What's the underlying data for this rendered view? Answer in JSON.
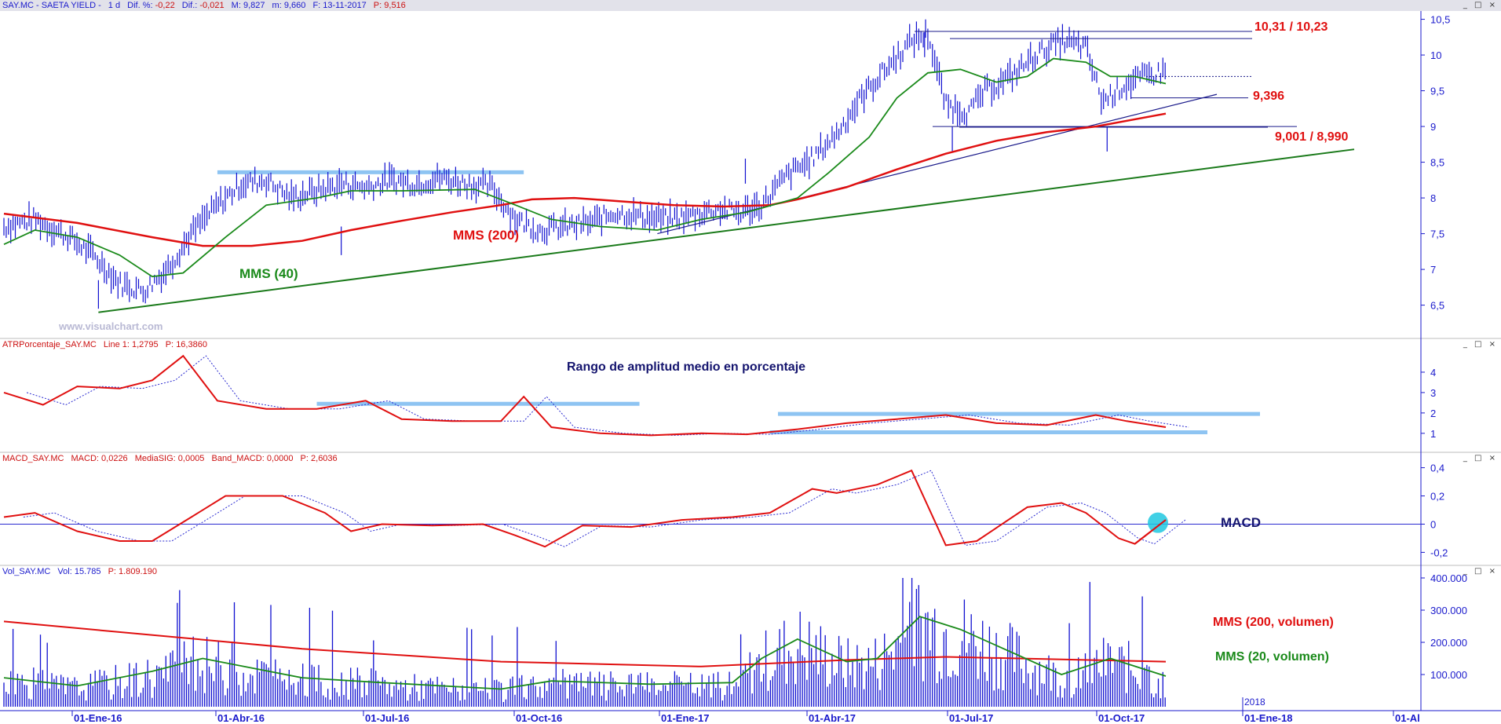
{
  "window_controls": "_ □ ×",
  "price_panel": {
    "symbol": "SAY.MC - SAETA YIELD -",
    "timeframe": "1 d",
    "dif_pct_label": "Dif. %:",
    "dif_pct_value": "-0,22",
    "dif_label": "Dif.:",
    "dif_value": "-0,021",
    "max_label": "M:",
    "max_value": "9,827",
    "min_label": "m:",
    "min_value": "9,660",
    "date_label": "F:",
    "date_value": "13-11-2017",
    "price_label": "P:",
    "price_value": "9,516",
    "watermark": "www.visualchart.com",
    "annotations": {
      "resistance": "10,31 / 10,23",
      "support1": "9,396",
      "support2": "9,001 / 8,990",
      "mms200": "MMS (200)",
      "mms40": "MMS (40)"
    }
  },
  "atr_panel": {
    "name": "ATRPorcentaje_SAY.MC",
    "line_label": "Line 1:",
    "line_value": "1,2795",
    "p_label": "P:",
    "p_value": "16,3860",
    "title": "Rango de amplitud medio en porcentaje"
  },
  "macd_panel": {
    "name": "MACD_SAY.MC",
    "macd_label": "MACD:",
    "macd_value": "0,0226",
    "sig_label": "MediaSIG:",
    "sig_value": "0,0005",
    "band_label": "Band_MACD:",
    "band_value": "0,0000",
    "p_label": "P:",
    "p_value": "2,6036",
    "title": "MACD"
  },
  "vol_panel": {
    "name": "Vol_SAY.MC",
    "vol_label": "Vol:",
    "vol_value": "15.785",
    "p_label": "P:",
    "p_value": "1.809.190",
    "annotations": {
      "mms200": "MMS (200, volumen)",
      "mms20": "MMS (20, volumen)"
    }
  },
  "colors": {
    "price_bars": "#1010d0",
    "mms200": "#e01010",
    "mms40": "#1a8a1a",
    "trendline_green": "#1a7a1a",
    "levels": "#1a1a8a",
    "bands": "#8ec4f2",
    "macd_highlight": "#20c8e0",
    "axis_text": "#1a1acc"
  },
  "chart_data": [
    {
      "type": "line",
      "panel": "price",
      "x_tick_labels": [
        "01-Ene-16",
        "01-Abr-16",
        "01-Jul-16",
        "01-Oct-16",
        "01-Ene-17",
        "01-Abr-17",
        "01-Jul-17",
        "01-Oct-17",
        "2018",
        "01-Ene-18",
        "01-Al"
      ],
      "y_tick_labels": [
        "6,5",
        "7",
        "7,5",
        "8",
        "8,5",
        "9",
        "9,5",
        "10",
        "10,5"
      ],
      "ylim": [
        6.1,
        10.55
      ],
      "series": [
        {
          "name": "MMS (200)",
          "x": [
            "2015-12-01",
            "2016-01-15",
            "2016-03-01",
            "2016-04-01",
            "2016-05-01",
            "2016-06-01",
            "2016-07-01",
            "2016-08-01",
            "2016-09-01",
            "2016-10-01",
            "2016-10-20",
            "2016-11-15",
            "2016-12-15",
            "2017-01-15",
            "2017-02-15",
            "2017-03-15",
            "2017-04-01",
            "2017-05-01",
            "2017-06-01",
            "2017-07-01",
            "2017-08-01",
            "2017-09-01",
            "2017-10-01",
            "2017-11-13"
          ],
          "values": [
            7.78,
            7.65,
            7.45,
            7.33,
            7.33,
            7.4,
            7.55,
            7.68,
            7.8,
            7.9,
            7.98,
            8.0,
            7.95,
            7.9,
            7.88,
            7.9,
            7.98,
            8.15,
            8.4,
            8.62,
            8.8,
            8.92,
            9.0,
            9.18
          ]
        },
        {
          "name": "MMS (40)",
          "x": [
            "2015-12-01",
            "2015-12-20",
            "2016-01-15",
            "2016-02-10",
            "2016-03-01",
            "2016-03-20",
            "2016-04-15",
            "2016-05-10",
            "2016-06-10",
            "2016-07-01",
            "2016-08-01",
            "2016-09-15",
            "2016-10-10",
            "2016-11-01",
            "2016-12-01",
            "2017-01-05",
            "2017-02-01",
            "2017-03-01",
            "2017-04-01",
            "2017-04-20",
            "2017-05-15",
            "2017-06-01",
            "2017-06-20",
            "2017-07-10",
            "2017-08-01",
            "2017-08-20",
            "2017-09-05",
            "2017-09-25",
            "2017-10-10",
            "2017-10-25",
            "2017-11-13"
          ],
          "values": [
            7.35,
            7.55,
            7.45,
            7.2,
            6.9,
            6.95,
            7.45,
            7.9,
            8.0,
            8.1,
            8.1,
            8.12,
            7.9,
            7.7,
            7.6,
            7.55,
            7.7,
            7.8,
            8.0,
            8.35,
            8.85,
            9.4,
            9.75,
            9.8,
            9.62,
            9.7,
            9.95,
            9.9,
            9.7,
            9.7,
            9.6
          ]
        },
        {
          "name": "price",
          "x": [
            "2015-12-01",
            "2015-12-20",
            "2016-01-10",
            "2016-01-25",
            "2016-02-10",
            "2016-02-25",
            "2016-03-10",
            "2016-03-25",
            "2016-04-10",
            "2016-04-25",
            "2016-05-10",
            "2016-05-25",
            "2016-06-10",
            "2016-06-25",
            "2016-07-10",
            "2016-07-25",
            "2016-08-10",
            "2016-08-25",
            "2016-09-10",
            "2016-09-25",
            "2016-10-10",
            "2016-10-25",
            "2016-11-10",
            "2016-11-25",
            "2016-12-10",
            "2016-12-25",
            "2017-01-10",
            "2017-01-25",
            "2017-02-10",
            "2017-02-25",
            "2017-03-10",
            "2017-03-25",
            "2017-04-10",
            "2017-04-25",
            "2017-05-10",
            "2017-05-25",
            "2017-06-10",
            "2017-06-20",
            "2017-07-01",
            "2017-07-15",
            "2017-07-25",
            "2017-08-10",
            "2017-08-25",
            "2017-09-10",
            "2017-09-25",
            "2017-10-05",
            "2017-10-20",
            "2017-11-01",
            "2017-11-13"
          ],
          "values": [
            7.6,
            7.7,
            7.45,
            7.2,
            6.8,
            6.7,
            7.0,
            7.5,
            7.9,
            8.2,
            8.25,
            8.0,
            8.1,
            8.2,
            8.15,
            8.25,
            8.2,
            8.28,
            8.2,
            8.15,
            7.7,
            7.55,
            7.6,
            7.65,
            7.8,
            7.75,
            7.7,
            7.75,
            7.85,
            7.8,
            7.9,
            8.3,
            8.55,
            8.9,
            9.4,
            9.8,
            10.2,
            10.3,
            9.3,
            9.2,
            9.5,
            9.7,
            10.0,
            10.2,
            10.1,
            9.35,
            9.6,
            9.7,
            9.78
          ]
        }
      ]
    },
    {
      "type": "line",
      "panel": "atr",
      "y_tick_labels": [
        "1",
        "2",
        "3",
        "4"
      ],
      "ylim": [
        0.3,
        5.0
      ],
      "series": [
        {
          "name": "atr",
          "x": [
            "2015-12-01",
            "2015-12-25",
            "2016-01-15",
            "2016-02-10",
            "2016-03-01",
            "2016-03-20",
            "2016-04-10",
            "2016-05-10",
            "2016-06-10",
            "2016-07-10",
            "2016-08-01",
            "2016-09-01",
            "2016-10-01",
            "2016-10-15",
            "2016-11-01",
            "2016-12-01",
            "2017-01-01",
            "2017-02-01",
            "2017-03-01",
            "2017-04-01",
            "2017-05-01",
            "2017-06-01",
            "2017-07-01",
            "2017-08-01",
            "2017-09-01",
            "2017-10-01",
            "2017-10-20",
            "2017-11-13"
          ],
          "values": [
            3.0,
            2.4,
            3.3,
            3.2,
            3.6,
            4.8,
            2.6,
            2.2,
            2.2,
            2.6,
            1.7,
            1.6,
            1.6,
            2.8,
            1.3,
            1.0,
            0.9,
            1.0,
            0.95,
            1.2,
            1.5,
            1.7,
            1.9,
            1.5,
            1.4,
            1.9,
            1.6,
            1.3
          ]
        }
      ]
    },
    {
      "type": "line",
      "panel": "macd",
      "y_tick_labels": [
        "-0,2",
        "0",
        "0,2",
        "0,4"
      ],
      "ylim": [
        -0.27,
        0.42
      ],
      "series": [
        {
          "name": "macd",
          "x": [
            "2015-12-01",
            "2015-12-20",
            "2016-01-15",
            "2016-02-10",
            "2016-03-01",
            "2016-03-25",
            "2016-04-15",
            "2016-05-20",
            "2016-06-15",
            "2016-07-01",
            "2016-07-20",
            "2016-08-20",
            "2016-09-20",
            "2016-10-10",
            "2016-10-28",
            "2016-11-20",
            "2016-12-20",
            "2017-01-20",
            "2017-02-20",
            "2017-03-15",
            "2017-04-10",
            "2017-04-25",
            "2017-05-20",
            "2017-06-10",
            "2017-07-01",
            "2017-07-20",
            "2017-08-20",
            "2017-09-10",
            "2017-09-25",
            "2017-10-15",
            "2017-10-25",
            "2017-11-13"
          ],
          "values": [
            0.05,
            0.08,
            -0.05,
            -0.12,
            -0.12,
            0.05,
            0.2,
            0.2,
            0.08,
            -0.05,
            0.0,
            -0.01,
            0.0,
            -0.08,
            -0.16,
            -0.01,
            -0.02,
            0.03,
            0.05,
            0.08,
            0.25,
            0.22,
            0.28,
            0.38,
            -0.15,
            -0.12,
            0.12,
            0.15,
            0.08,
            -0.1,
            -0.14,
            0.03
          ]
        }
      ]
    },
    {
      "type": "bar",
      "panel": "volume",
      "y_tick_labels": [
        "100.000",
        "200.000",
        "300.000",
        "400.000"
      ],
      "ylim": [
        0,
        400000
      ],
      "series": [
        {
          "name": "MMS (200, volumen)",
          "x": [
            "2015-12-01",
            "2016-06-01",
            "2016-10-01",
            "2017-02-01",
            "2017-05-01",
            "2017-07-01",
            "2017-11-13"
          ],
          "values": [
            265000,
            180000,
            140000,
            125000,
            145000,
            155000,
            140000
          ]
        },
        {
          "name": "MMS (20, volumen)",
          "x": [
            "2015-12-01",
            "2016-01-15",
            "2016-03-01",
            "2016-04-01",
            "2016-06-01",
            "2016-07-20",
            "2016-10-01",
            "2016-11-01",
            "2017-01-01",
            "2017-02-20",
            "2017-03-10",
            "2017-04-01",
            "2017-05-01",
            "2017-05-20",
            "2017-06-15",
            "2017-07-10",
            "2017-08-10",
            "2017-09-10",
            "2017-10-10",
            "2017-11-13"
          ],
          "values": [
            90000,
            65000,
            110000,
            150000,
            90000,
            75000,
            55000,
            80000,
            70000,
            75000,
            150000,
            210000,
            140000,
            150000,
            280000,
            240000,
            170000,
            100000,
            150000,
            95000
          ]
        }
      ]
    }
  ]
}
